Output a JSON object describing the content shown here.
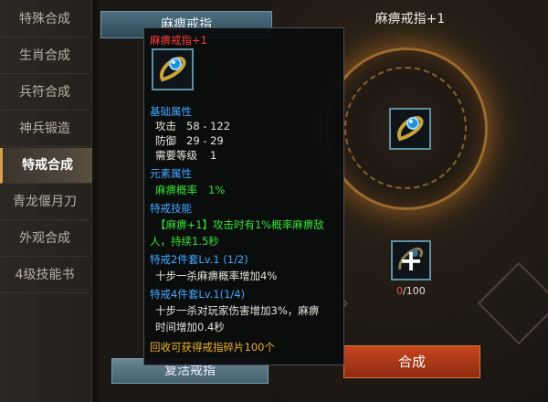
{
  "nav": {
    "items": [
      {
        "label": "特殊合成",
        "active": false
      },
      {
        "label": "生肖合成",
        "active": false
      },
      {
        "label": "兵符合成",
        "active": false
      },
      {
        "label": "神兵锻造",
        "active": false
      },
      {
        "label": "特戒合成",
        "active": true
      },
      {
        "label": "青龙偃月刀",
        "active": false
      },
      {
        "label": "外观合成",
        "active": false
      },
      {
        "label": "4级技能书",
        "active": false
      }
    ]
  },
  "list": {
    "header": "麻痹戒指",
    "bottom_button": "复活戒指"
  },
  "tooltip": {
    "name": "麻痹戒指+1",
    "basic_heading": "基础属性",
    "attack_label": "攻击",
    "attack_value": "58 - 122",
    "defense_label": "防御",
    "defense_value": "29 - 29",
    "level_label": "需要等级",
    "level_value": "1",
    "element_heading": "元素属性",
    "element_label": "麻痹概率",
    "element_value": "1%",
    "skill_heading": "特戒技能",
    "skill_line1": "【麻痹+1】攻击时有1%概率麻痹敌",
    "skill_line2": "人，持续1.5秒",
    "set2_heading": "特戒2件套Lv.1 (1/2)",
    "set2_desc": "十步一杀麻痹概率增加4%",
    "set4_heading": "特戒4件套Lv.1(1/4)",
    "set4_desc_line1": "十步一杀对玩家伤害增加3%，麻痹",
    "set4_desc_line2": "时间增加0.4秒",
    "recycle_note": "回收可获得戒指碎片100个"
  },
  "craft": {
    "title": "麻痹戒指+1",
    "material_current": "0",
    "material_total": "/100",
    "craft_button": "合成"
  },
  "icons": [
    "ring-icon",
    "plus-icon",
    "material-icon"
  ]
}
